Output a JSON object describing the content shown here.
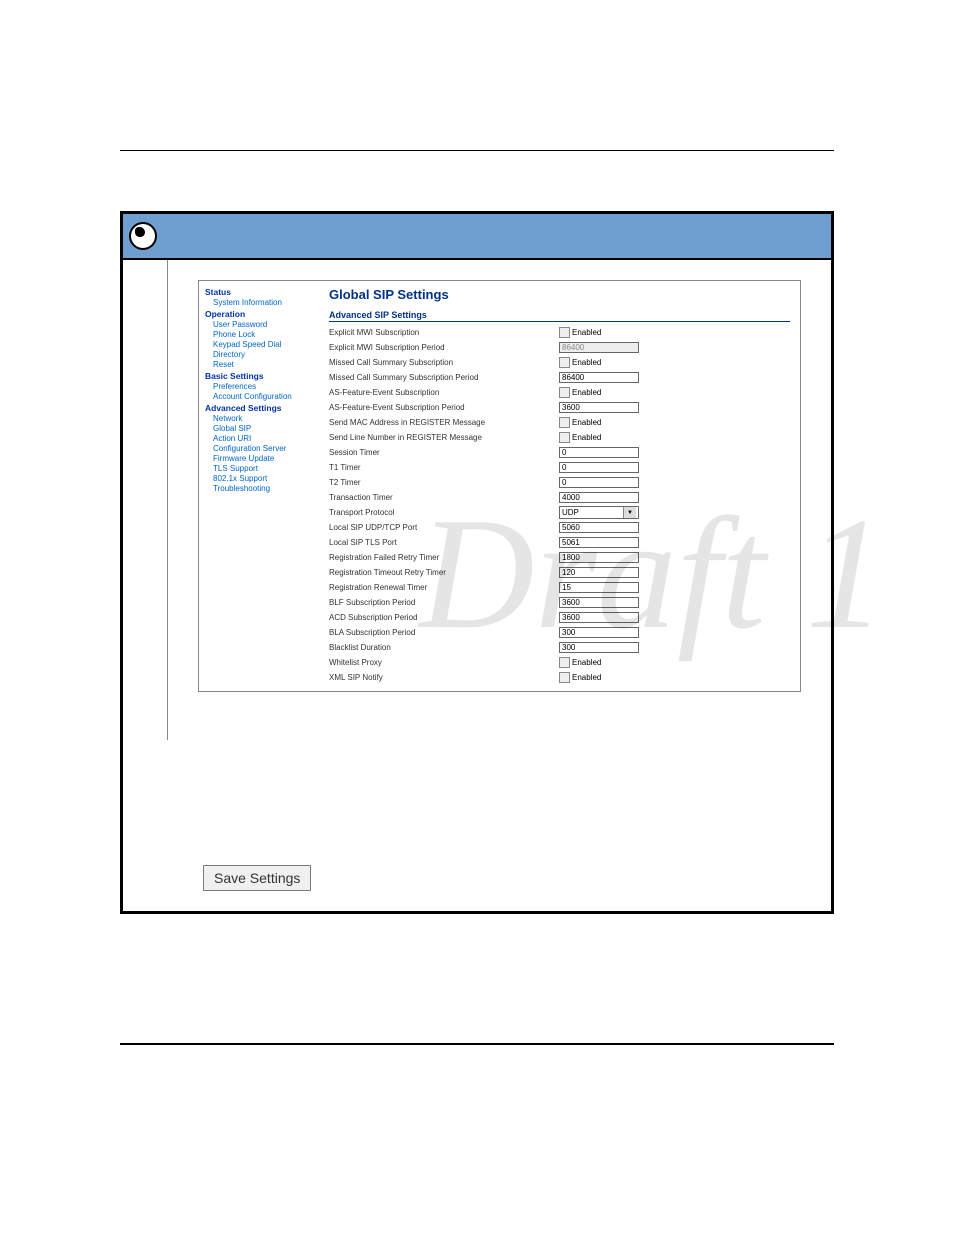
{
  "watermark": "Draft 1",
  "page_title": "Global SIP Settings",
  "section_title": "Advanced SIP Settings",
  "enabled_label": "Enabled",
  "save_button": "Save Settings",
  "sidebar": {
    "groups": [
      {
        "header": "Status",
        "items": [
          "System Information"
        ]
      },
      {
        "header": "Operation",
        "items": [
          "User Password",
          "Phone Lock",
          "Keypad Speed Dial",
          "Directory",
          "Reset"
        ]
      },
      {
        "header": "Basic Settings",
        "items": [
          "Preferences",
          "Account Configuration"
        ]
      },
      {
        "header": "Advanced Settings",
        "items": [
          "Network",
          "Global SIP",
          "Action URI",
          "Configuration Server",
          "Firmware Update",
          "TLS Support",
          "802.1x Support",
          "Troubleshooting"
        ]
      }
    ]
  },
  "fields": [
    {
      "label": "Explicit MWI Subscription",
      "type": "checkbox",
      "value": false
    },
    {
      "label": "Explicit MWI Subscription Period",
      "type": "text",
      "value": "86400",
      "disabled": true
    },
    {
      "label": "Missed Call Summary Subscription",
      "type": "checkbox",
      "value": false
    },
    {
      "label": "Missed Call Summary Subscription Period",
      "type": "text",
      "value": "86400"
    },
    {
      "label": "AS-Feature-Event Subscription",
      "type": "checkbox",
      "value": false
    },
    {
      "label": "AS-Feature-Event Subscription Period",
      "type": "text",
      "value": "3600"
    },
    {
      "label": "Send MAC Address in REGISTER Message",
      "type": "checkbox",
      "value": false
    },
    {
      "label": "Send Line Number in REGISTER Message",
      "type": "checkbox",
      "value": false
    },
    {
      "label": "Session Timer",
      "type": "text",
      "value": "0"
    },
    {
      "label": "T1 Timer",
      "type": "text",
      "value": "0"
    },
    {
      "label": "T2 Timer",
      "type": "text",
      "value": "0"
    },
    {
      "label": "Transaction Timer",
      "type": "text",
      "value": "4000"
    },
    {
      "label": "Transport Protocol",
      "type": "select",
      "value": "UDP"
    },
    {
      "label": "Local SIP UDP/TCP Port",
      "type": "text",
      "value": "5060"
    },
    {
      "label": "Local SIP TLS Port",
      "type": "text",
      "value": "5061"
    },
    {
      "label": "Registration Failed Retry Timer",
      "type": "text",
      "value": "1800"
    },
    {
      "label": "Registration Timeout Retry Timer",
      "type": "text",
      "value": "120"
    },
    {
      "label": "Registration Renewal Timer",
      "type": "text",
      "value": "15"
    },
    {
      "label": "BLF Subscription Period",
      "type": "text",
      "value": "3600"
    },
    {
      "label": "ACD Subscription Period",
      "type": "text",
      "value": "3600"
    },
    {
      "label": "BLA Subscription Period",
      "type": "text",
      "value": "300"
    },
    {
      "label": "Blacklist Duration",
      "type": "text",
      "value": "300"
    },
    {
      "label": "Whitelist Proxy",
      "type": "checkbox",
      "value": false
    },
    {
      "label": "XML SIP Notify",
      "type": "checkbox",
      "value": false
    }
  ]
}
